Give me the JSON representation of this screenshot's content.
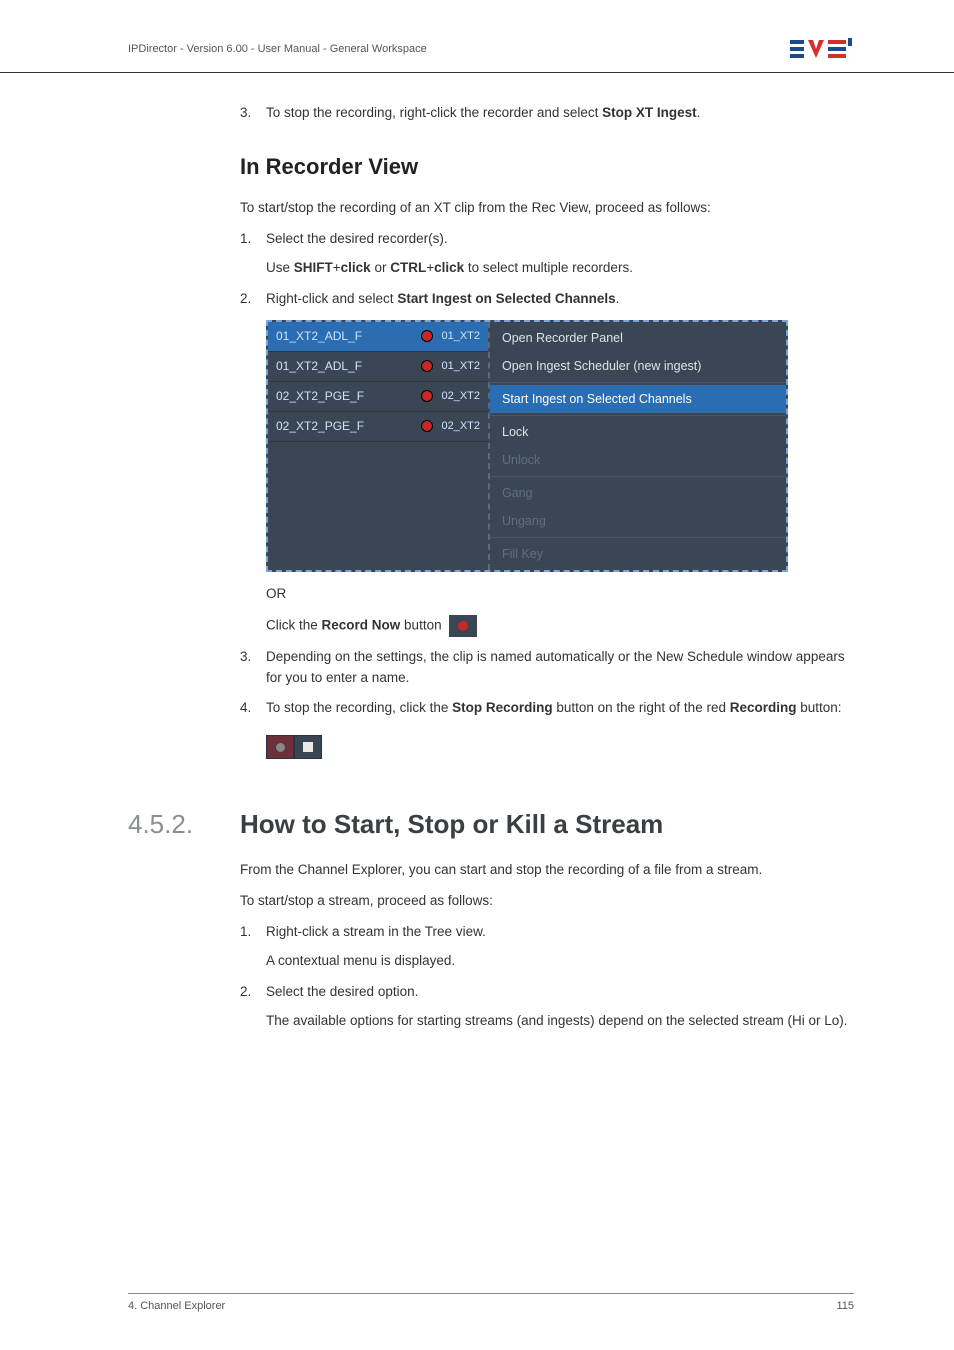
{
  "header": {
    "text": "IPDirector - Version 6.00 - User Manual - General Workspace"
  },
  "step_top": {
    "num": "3.",
    "pre": "To stop the recording, right-click the recorder and select ",
    "bold": "Stop XT Ingest",
    "post": "."
  },
  "subsection_title": "In Recorder View",
  "intro": "To start/stop the recording of an XT clip from the Rec View, proceed as follows:",
  "steps_a": [
    {
      "num": "1.",
      "text": "Select the desired recorder(s).",
      "sub_pre": "Use ",
      "sub_b1": "SHIFT",
      "sub_mid1": "+",
      "sub_b2": "click",
      "sub_mid2": " or ",
      "sub_b3": "CTRL",
      "sub_mid3": "+",
      "sub_b4": "click",
      "sub_post": " to select multiple recorders."
    },
    {
      "num": "2.",
      "pre": "Right-click and select ",
      "bold": "Start Ingest on Selected Channels",
      "post": "."
    }
  ],
  "screenshot": {
    "recorders": [
      {
        "name": "01_XT2_ADL_F",
        "ch": "01_XT2",
        "selected": true
      },
      {
        "name": "01_XT2_ADL_F",
        "ch": "01_XT2",
        "selected": false
      },
      {
        "name": "02_XT2_PGE_F",
        "ch": "02_XT2",
        "selected": false
      },
      {
        "name": "02_XT2_PGE_F",
        "ch": "02_XT2",
        "selected": false
      }
    ],
    "menu": [
      {
        "label": "Open Recorder Panel",
        "state": "normal"
      },
      {
        "label": "Open Ingest Scheduler (new ingest)",
        "state": "normal"
      },
      {
        "label": "Start Ingest on Selected Channels",
        "state": "selected"
      },
      {
        "label": "Lock",
        "state": "normal"
      },
      {
        "label": "Unlock",
        "state": "disabled"
      },
      {
        "label": "Gang",
        "state": "disabled"
      },
      {
        "label": "Ungang",
        "state": "disabled"
      },
      {
        "label": "Fill Key",
        "state": "disabled"
      }
    ]
  },
  "or_label": "OR",
  "record_now": {
    "pre": "Click the ",
    "bold": "Record Now",
    "post": " button"
  },
  "step3": {
    "num": "3.",
    "text": "Depending on the settings, the clip is named automatically or the New Schedule window appears for you to enter a name."
  },
  "step4": {
    "num": "4.",
    "pre": "To stop the recording, click the ",
    "b1": "Stop Recording",
    "mid": " button on the right of the red ",
    "b2": "Recording",
    "post": " button:"
  },
  "section": {
    "num": "4.5.2.",
    "title": "How to Start, Stop or Kill a Stream"
  },
  "section_body": {
    "p1": "From the Channel Explorer, you can start and stop the recording of a file from a stream.",
    "p2": "To start/stop a stream, proceed as follows:"
  },
  "steps_b": [
    {
      "num": "1.",
      "text": "Right-click a stream in the Tree view.",
      "sub": "A contextual menu is displayed."
    },
    {
      "num": "2.",
      "text": "Select the desired option.",
      "sub": "The available options for starting streams (and ingests) depend on the selected stream (Hi or Lo)."
    }
  ],
  "footer": {
    "left": "4. Channel Explorer",
    "right": "115"
  }
}
